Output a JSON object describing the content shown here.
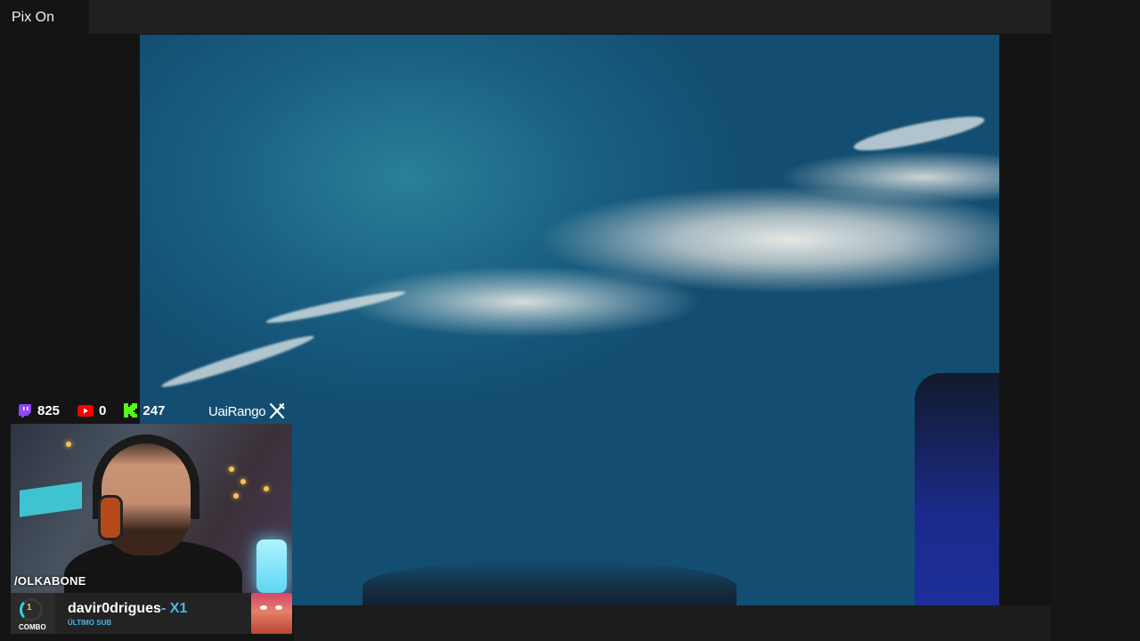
{
  "topbar": {
    "label": "Pix On"
  },
  "stats": {
    "twitch": {
      "icon": "twitch-icon",
      "count": "825",
      "color": "#9146ff"
    },
    "youtube": {
      "icon": "youtube-icon",
      "count": "0",
      "color": "#ff0000"
    },
    "kick": {
      "icon": "kick-icon",
      "count": "247",
      "color": "#53fc18"
    }
  },
  "sponsor": {
    "name": "UaiRango",
    "icon": "crossed-utensils-icon"
  },
  "webcam": {
    "handle": "/OLKABONE"
  },
  "subscriber": {
    "combo_count": "1",
    "combo_label": "COMBO",
    "name": "davir0drigues",
    "multiplier": "- X1",
    "caption": "ÚLTIMO SUB"
  }
}
